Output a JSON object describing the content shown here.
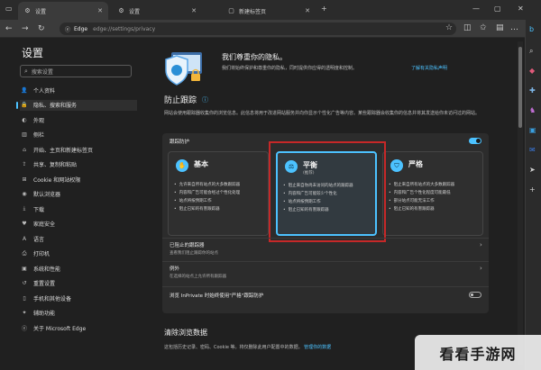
{
  "tabs": [
    {
      "label": "设置",
      "icon": "gear-icon",
      "glyph": "⚙"
    },
    {
      "label": "设置",
      "icon": "gear-icon",
      "glyph": "⚙"
    },
    {
      "label": "新建标签页",
      "icon": "new-tab-icon",
      "glyph": "▢"
    }
  ],
  "address": {
    "scheme": "Edge",
    "path": "edge://settings/privacy"
  },
  "sidebar": {
    "title": "设置",
    "search_placeholder": "搜索设置",
    "items": [
      {
        "label": "个人资料",
        "glyph": "👤"
      },
      {
        "label": "隐私、搜索和服务",
        "glyph": "🔒"
      },
      {
        "label": "外观",
        "glyph": "◐"
      },
      {
        "label": "侧栏",
        "glyph": "▥"
      },
      {
        "label": "开始、主页和新建标签页",
        "glyph": "⌂"
      },
      {
        "label": "共享、复制和粘贴",
        "glyph": "⇪"
      },
      {
        "label": "Cookie 和网站权限",
        "glyph": "⊞"
      },
      {
        "label": "默认浏览器",
        "glyph": "◉"
      },
      {
        "label": "下载",
        "glyph": "⤓"
      },
      {
        "label": "家庭安全",
        "glyph": "♥"
      },
      {
        "label": "语言",
        "glyph": "A"
      },
      {
        "label": "打印机",
        "glyph": "⎙"
      },
      {
        "label": "系统和性能",
        "glyph": "▣"
      },
      {
        "label": "重置设置",
        "glyph": "↺"
      },
      {
        "label": "手机和其他设备",
        "glyph": "▯"
      },
      {
        "label": "辅助功能",
        "glyph": "✦"
      },
      {
        "label": "关于 Microsoft Edge",
        "glyph": "ⓔ"
      }
    ]
  },
  "hero": {
    "title": "我们尊重你的隐私。",
    "desc": "我们将始终保护和尊重你的隐私，同时提供你应得的透明度和控制。",
    "link": "了解有关隐私声明"
  },
  "tracking": {
    "title": "防止跟踪",
    "desc": "网站会使用跟踪器收集你的浏览信息。此信息将用于改进网站服务并向你显示个性化广告等内容。某些跟踪器会收集你的信息并将其发送给你未访问过的网站。",
    "toggle_label": "跟踪防护",
    "options": [
      {
        "name": "基本",
        "sub": "",
        "glyph": "✋",
        "bullets": [
          "允许来自所有站点的大多数跟踪器",
          "内容和广告可能会经过个性化处理",
          "站点将按预期工作",
          "阻止已知的有害跟踪器"
        ]
      },
      {
        "name": "平衡",
        "sub": "(推荐)",
        "glyph": "⚖",
        "bullets": [
          "阻止来自你尚未访问的站点的跟踪器",
          "内容和广告可能较少个性化",
          "站点将按预期工作",
          "阻止已知的有害跟踪器"
        ]
      },
      {
        "name": "严格",
        "sub": "",
        "glyph": "⛉",
        "bullets": [
          "阻止来自所有站点的大多数跟踪器",
          "内容和广告个性化程度可能最低",
          "部分站点可能无法工作",
          "阻止已知的有害跟踪器"
        ]
      }
    ],
    "blocked_title": "已阻止的跟踪器",
    "blocked_sub": "查看我们阻止跟踪你的站点",
    "exceptions_title": "例外",
    "exceptions_sub": "在选择的站点上允许所有跟踪器",
    "inprivate_label": "浏览 InPrivate 时始终使用\"严格\"跟踪防护"
  },
  "clear": {
    "title": "清除浏览数据",
    "desc": "这包括历史记录、密码、Cookie 等。将仅删除此用户配置中的数据。",
    "link": "管理你的数据"
  },
  "watermark": "看看手游网"
}
